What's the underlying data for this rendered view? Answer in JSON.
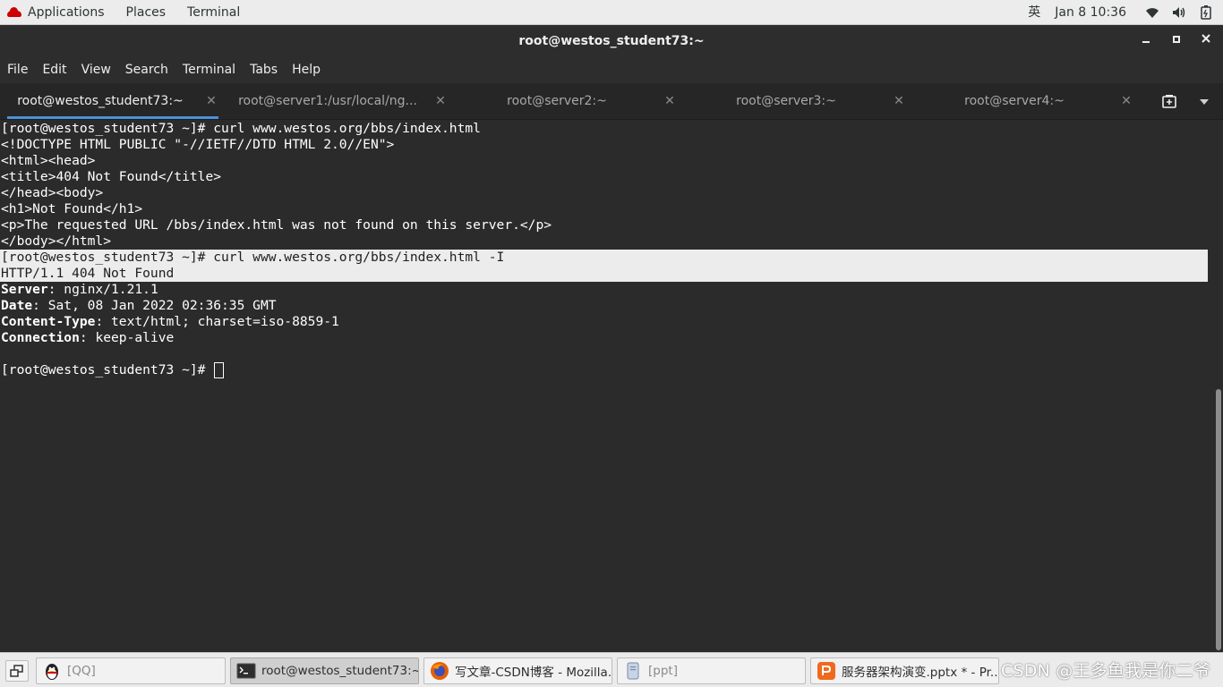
{
  "topbar": {
    "applications": "Applications",
    "places": "Places",
    "terminal": "Terminal",
    "input_method": "英",
    "datetime": "Jan 8  10:36"
  },
  "window": {
    "title": "root@westos_student73:~"
  },
  "menu": [
    "File",
    "Edit",
    "View",
    "Search",
    "Terminal",
    "Tabs",
    "Help"
  ],
  "tabs": [
    {
      "label": "root@westos_student73:~",
      "active": true
    },
    {
      "label": "root@server1:/usr/local/ng...",
      "active": false
    },
    {
      "label": "root@server2:~",
      "active": false
    },
    {
      "label": "root@server3:~",
      "active": false
    },
    {
      "label": "root@server4:~",
      "active": false
    }
  ],
  "terminal": {
    "lines": [
      "[root@westos_student73 ~]# curl www.westos.org/bbs/index.html",
      "<!DOCTYPE HTML PUBLIC \"-//IETF//DTD HTML 2.0//EN\">",
      "<html><head>",
      "<title>404 Not Found</title>",
      "</head><body>",
      "<h1>Not Found</h1>",
      "<p>The requested URL /bbs/index.html was not found on this server.</p>",
      "</body></html>",
      "[root@westos_student73 ~]# curl www.westos.org/bbs/index.html -I",
      "HTTP/1.1 404 Not Found"
    ],
    "headers": [
      {
        "key": "Server",
        "value": ": nginx/1.21.1"
      },
      {
        "key": "Date",
        "value": ": Sat, 08 Jan 2022 02:36:35 GMT"
      },
      {
        "key": "Content-Type",
        "value": ": text/html; charset=iso-8859-1"
      },
      {
        "key": "Connection",
        "value": ": keep-alive"
      }
    ],
    "prompt": "[root@westos_student73 ~]# "
  },
  "taskbar": {
    "items": [
      {
        "label": "[QQ]",
        "icon": "qq-penguin-icon"
      },
      {
        "label": "root@westos_student73:~",
        "icon": "terminal-icon"
      },
      {
        "label": "写文章-CSDN博客 - Mozilla...",
        "icon": "firefox-icon"
      },
      {
        "label": "[ppt]",
        "icon": "file-icon"
      },
      {
        "label": "服务器架构演变.pptx * - Pr...",
        "icon": "presentation-icon"
      }
    ],
    "watermark": "CSDN @王多鱼我是你二爷"
  },
  "colors": {
    "terminal_bg": "#2b2b2b",
    "tab_accent": "#4a90d9",
    "selection_bg": "#ececec"
  }
}
